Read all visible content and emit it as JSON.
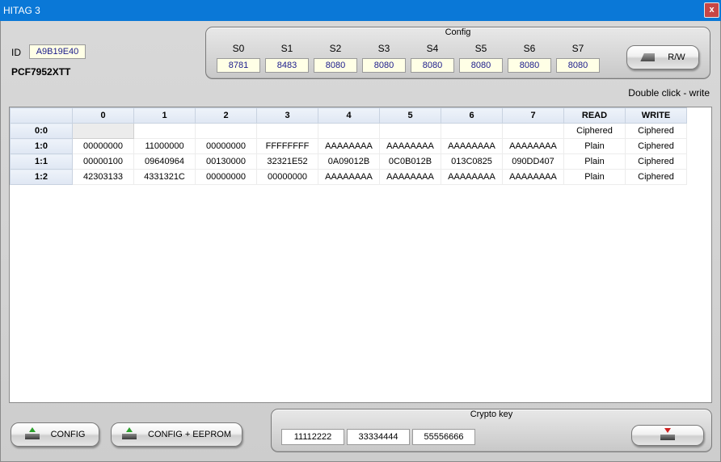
{
  "window": {
    "title": "HITAG 3",
    "close_label": "x"
  },
  "tag": {
    "id_label": "ID",
    "id_value": "A9B19E40",
    "chip": "PCF7952XTT"
  },
  "config": {
    "title": "Config",
    "fields": [
      {
        "label": "S0",
        "value": "8781"
      },
      {
        "label": "S1",
        "value": "8483"
      },
      {
        "label": "S2",
        "value": "8080"
      },
      {
        "label": "S3",
        "value": "8080"
      },
      {
        "label": "S4",
        "value": "8080"
      },
      {
        "label": "S5",
        "value": "8080"
      },
      {
        "label": "S6",
        "value": "8080"
      },
      {
        "label": "S7",
        "value": "8080"
      }
    ],
    "rw_label": "R/W"
  },
  "hint": "Double click - write",
  "grid": {
    "columns": [
      "",
      "0",
      "1",
      "2",
      "3",
      "4",
      "5",
      "6",
      "7",
      "READ",
      "WRITE"
    ],
    "rows": [
      {
        "label": "0:0",
        "cells": [
          "",
          "",
          "",
          "",
          "",
          "",
          "",
          ""
        ],
        "read": "Ciphered",
        "write": "Ciphered"
      },
      {
        "label": "1:0",
        "cells": [
          "00000000",
          "11000000",
          "00000000",
          "FFFFFFFF",
          "AAAAAAAA",
          "AAAAAAAA",
          "AAAAAAAA",
          "AAAAAAAA"
        ],
        "read": "Plain",
        "write": "Ciphered"
      },
      {
        "label": "1:1",
        "cells": [
          "00000100",
          "09640964",
          "00130000",
          "32321E52",
          "0A09012B",
          "0C0B012B",
          "013C0825",
          "090DD407"
        ],
        "read": "Plain",
        "write": "Ciphered"
      },
      {
        "label": "1:2",
        "cells": [
          "42303133",
          "4331321C",
          "00000000",
          "00000000",
          "AAAAAAAA",
          "AAAAAAAA",
          "AAAAAAAA",
          "AAAAAAAA"
        ],
        "read": "Plain",
        "write": "Ciphered"
      }
    ]
  },
  "buttons": {
    "config": "CONFIG",
    "config_eeprom": "CONFIG + EEPROM"
  },
  "crypto": {
    "title": "Crypto key",
    "keys": [
      "11112222",
      "33334444",
      "55556666"
    ]
  },
  "colors": {
    "titlebar": "#0a78d7",
    "close": "#c74646",
    "field_bg": "#ffffe6",
    "field_text": "#1a1a8a",
    "header_bg": "#dfe7f3"
  }
}
